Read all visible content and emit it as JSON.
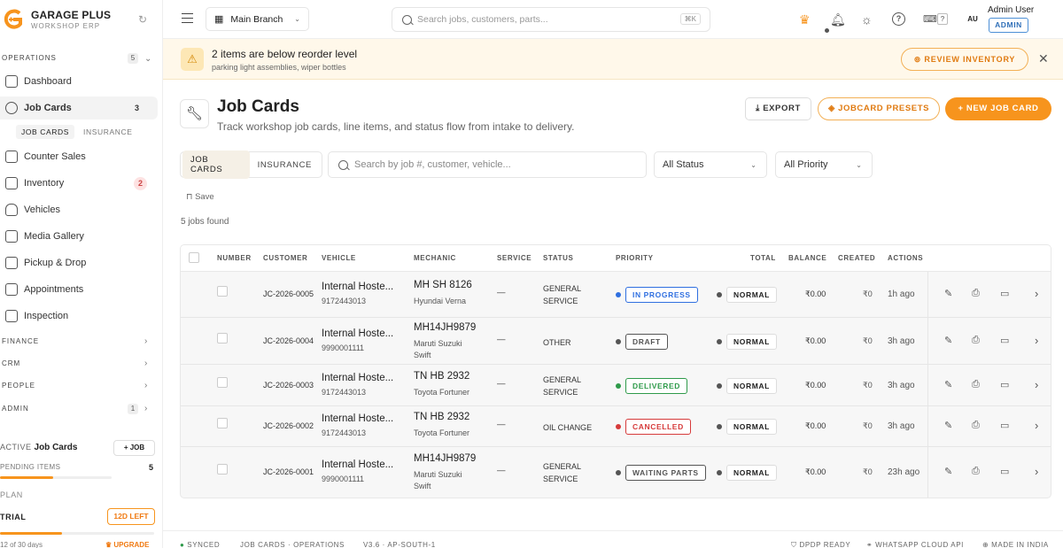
{
  "brand": {
    "name": "GARAGE PLUS",
    "subtitle": "WORKSHOP ERP"
  },
  "sidebar": {
    "operations_label": "OPERATIONS",
    "operations_count": "5",
    "items": [
      {
        "label": "Dashboard"
      },
      {
        "label": "Job Cards",
        "badge": "3"
      },
      {
        "label": "Counter Sales"
      },
      {
        "label": "Inventory",
        "badge": "2"
      },
      {
        "label": "Vehicles"
      },
      {
        "label": "Media Gallery"
      },
      {
        "label": "Pickup & Drop"
      },
      {
        "label": "Appointments"
      },
      {
        "label": "Inspection"
      }
    ],
    "subtabs": [
      "JOB CARDS",
      "INSURANCE"
    ],
    "sections": [
      {
        "label": "FINANCE"
      },
      {
        "label": "CRM"
      },
      {
        "label": "PEOPLE"
      },
      {
        "label": "ADMIN",
        "count": "1"
      }
    ],
    "active_label": "ACTIVE",
    "active_value": "Job Cards",
    "job_button": "+ JOB",
    "pending_label": "PENDING ITEMS",
    "pending_value": "5",
    "pending_progress": 0.48,
    "plan_label": "PLAN",
    "plan_value": "TRIAL",
    "days_left": "12D LEFT",
    "trial_progress": 0.4,
    "days_text": "12 of 30 days",
    "upgrade": "UPGRADE"
  },
  "topbar": {
    "branch": "Main Branch",
    "search_placeholder": "Search jobs, customers, parts...",
    "shortcut": "⌘K",
    "help_key": "?",
    "avatar": "AU",
    "user_name": "Admin User",
    "role": "ADMIN"
  },
  "alert": {
    "title": "2 items are below reorder level",
    "subtitle": "parking light assemblies, wiper bottles",
    "button": "REVIEW INVENTORY"
  },
  "page": {
    "title": "Job Cards",
    "subtitle": "Track workshop job cards, line items, and status flow from intake to delivery.",
    "export": "EXPORT",
    "presets": "JOBCARD PRESETS",
    "new_job": "+ NEW JOB CARD",
    "tabs": [
      "JOB CARDS",
      "INSURANCE"
    ],
    "search_placeholder": "Search by job #, customer, vehicle...",
    "status_filter": "All Status",
    "priority_filter": "All Priority",
    "save": "Save",
    "found": "5 jobs found"
  },
  "table": {
    "headers": [
      "NUMBER",
      "CUSTOMER",
      "VEHICLE",
      "MECHANIC",
      "SERVICE",
      "STATUS",
      "PRIORITY",
      "TOTAL",
      "BALANCE",
      "CREATED",
      "ACTIONS"
    ],
    "rows": [
      {
        "number": "JC-2026-0005",
        "customer": "Internal Hoste...",
        "phone": "9172443013",
        "plate": "MH SH 8126",
        "model": "Hyundai Verna",
        "mechanic": "—",
        "service": "GENERAL SERVICE",
        "status": "IN PROGRESS",
        "status_color": "#2f6fe0",
        "priority": "NORMAL",
        "total": "₹0.00",
        "balance": "₹0",
        "created": "1h ago"
      },
      {
        "number": "JC-2026-0004",
        "customer": "Internal Hoste...",
        "phone": "9990001111",
        "plate": "MH14JH9879",
        "model": "Maruti Suzuki Swift",
        "mechanic": "—",
        "service": "OTHER",
        "status": "DRAFT",
        "status_color": "#555555",
        "priority": "NORMAL",
        "total": "₹0.00",
        "balance": "₹0",
        "created": "3h ago"
      },
      {
        "number": "JC-2026-0003",
        "customer": "Internal Hoste...",
        "phone": "9172443013",
        "plate": "TN HB 2932",
        "model": "Toyota Fortuner",
        "mechanic": "—",
        "service": "GENERAL SERVICE",
        "status": "DELIVERED",
        "status_color": "#2e9a4a",
        "priority": "NORMAL",
        "total": "₹0.00",
        "balance": "₹0",
        "created": "3h ago"
      },
      {
        "number": "JC-2026-0002",
        "customer": "Internal Hoste...",
        "phone": "9172443013",
        "plate": "TN HB 2932",
        "model": "Toyota Fortuner",
        "mechanic": "—",
        "service": "OIL CHANGE",
        "status": "CANCELLED",
        "status_color": "#d63a3a",
        "priority": "NORMAL",
        "total": "₹0.00",
        "balance": "₹0",
        "created": "3h ago"
      },
      {
        "number": "JC-2026-0001",
        "customer": "Internal Hoste...",
        "phone": "9990001111",
        "plate": "MH14JH9879",
        "model": "Maruti Suzuki Swift",
        "mechanic": "—",
        "service": "GENERAL SERVICE",
        "status": "WAITING PARTS",
        "status_color": "#555555",
        "priority": "NORMAL",
        "total": "₹0.00",
        "balance": "₹0",
        "created": "23h ago"
      }
    ]
  },
  "footer": {
    "synced": "SYNCED",
    "breadcrumb": "JOB CARDS · OPERATIONS",
    "version": "V3.6 · AP-SOUTH-1",
    "dpdp": "DPDP READY",
    "whatsapp": "WHATSAPP CLOUD API",
    "made": "MADE IN INDIA"
  },
  "colors": {
    "accent": "#f7941d",
    "alert_bg": "#fff8ea",
    "role_blue": "#2f6fb8"
  }
}
